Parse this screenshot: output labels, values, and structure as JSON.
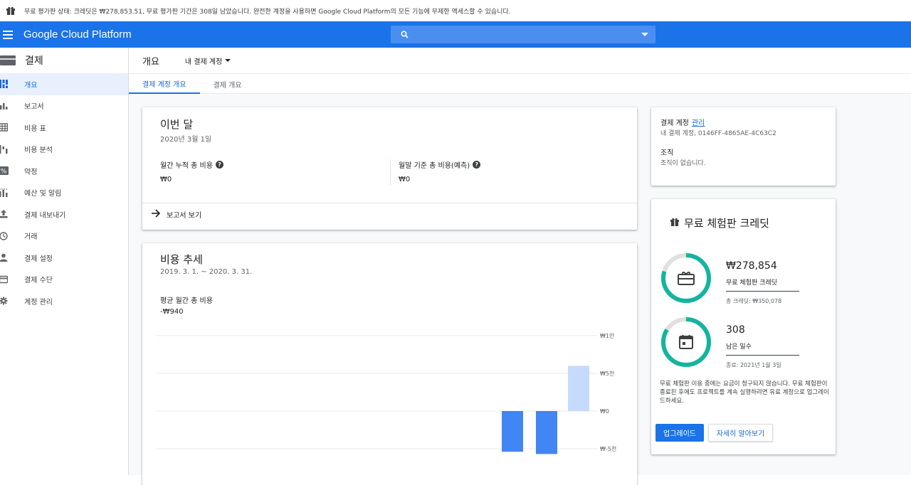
{
  "trial_banner": {
    "message": "무료 평가판 상태: 크레딧은 ₩278,853.51, 무료 평가판 기간은 308일 남았습니다. 완전한 계정을 사용하면 Google Cloud Platform의 모든 기능에 무제한 액세스할 수 있습니다."
  },
  "header": {
    "brand": "Google Cloud Platform",
    "search_placeholder": ""
  },
  "sidebar": {
    "title": "결제",
    "items": [
      {
        "label": "개요",
        "icon": "dashboard-icon",
        "active": true
      },
      {
        "label": "보고서",
        "icon": "bar-chart-icon"
      },
      {
        "label": "비용 표",
        "icon": "table-icon"
      },
      {
        "label": "비용 분석",
        "icon": "cost-breakdown-icon"
      },
      {
        "label": "약정",
        "icon": "percent-icon"
      },
      {
        "label": "예산 및 알림",
        "icon": "budget-icon"
      },
      {
        "label": "결제 내보내기",
        "icon": "export-icon"
      },
      {
        "label": "거래",
        "icon": "clock-icon"
      },
      {
        "label": "결제 설정",
        "icon": "person-icon"
      },
      {
        "label": "결제 수단",
        "icon": "credit-card-icon"
      },
      {
        "label": "계정 관리",
        "icon": "gear-icon"
      }
    ]
  },
  "page": {
    "title": "개요",
    "account_selector": "내 결제 계정",
    "tabs": [
      {
        "label": "결제 계정 개요",
        "active": true
      },
      {
        "label": "결제 개요",
        "active": false
      }
    ]
  },
  "this_month": {
    "title": "이번 달",
    "date": "2020년 3월 1일",
    "month_to_date_label": "월간 누적 총 비용",
    "month_to_date_value": "₩0",
    "forecast_label": "월말 기준 총 비용(예측)",
    "forecast_value": "₩0",
    "view_report": "보고서 보기"
  },
  "cost_trend": {
    "title": "비용 추세",
    "range": "2019. 3. 1. ~ 2020. 3. 31.",
    "avg_label": "평균 월간 총 비용",
    "avg_value": "-₩940"
  },
  "chart_data": {
    "type": "bar",
    "ylim": [
      -5000,
      10000
    ],
    "ytick_labels": [
      "₩1만",
      "₩5천",
      "₩0",
      "₩-5천"
    ],
    "ytick_values": [
      10000,
      5000,
      0,
      -5000
    ],
    "bars": [
      {
        "value": -5400,
        "color": "#4285f4"
      },
      {
        "value": -5700,
        "color": "#4285f4"
      },
      {
        "value": 6000,
        "color": "#c6dafc"
      }
    ]
  },
  "account": {
    "label": "결제 계정",
    "manage_link": "관리",
    "id_line": "내 결제 계정, 0146FF-4865AE-4C63C2",
    "org_label": "조직",
    "org_value": "조직이 없습니다."
  },
  "credit": {
    "title": "무료 체험판 크레딧",
    "amount": "₩278,854",
    "amount_label": "무료 체험판 크레딧",
    "total": "총 크레딧: ₩350,078",
    "credit_fraction": 0.7965,
    "days": "308",
    "days_label": "남은 일수",
    "end_date": "종료: 2021년 1월 3일",
    "days_fraction": 0.84,
    "note": "무료 체험판 이용 중에는 요금이 청구되지 않습니다. 무료 체험판이 종료된 후에도 프로젝트를 계속 실행하려면 유료 계정으로 업그레이드하세요.",
    "upgrade_button": "업그레이드",
    "learn_more_button": "자세히 알아보기",
    "ring_color": "#12b5a0",
    "ring_track_color": "#e0e0e0"
  }
}
